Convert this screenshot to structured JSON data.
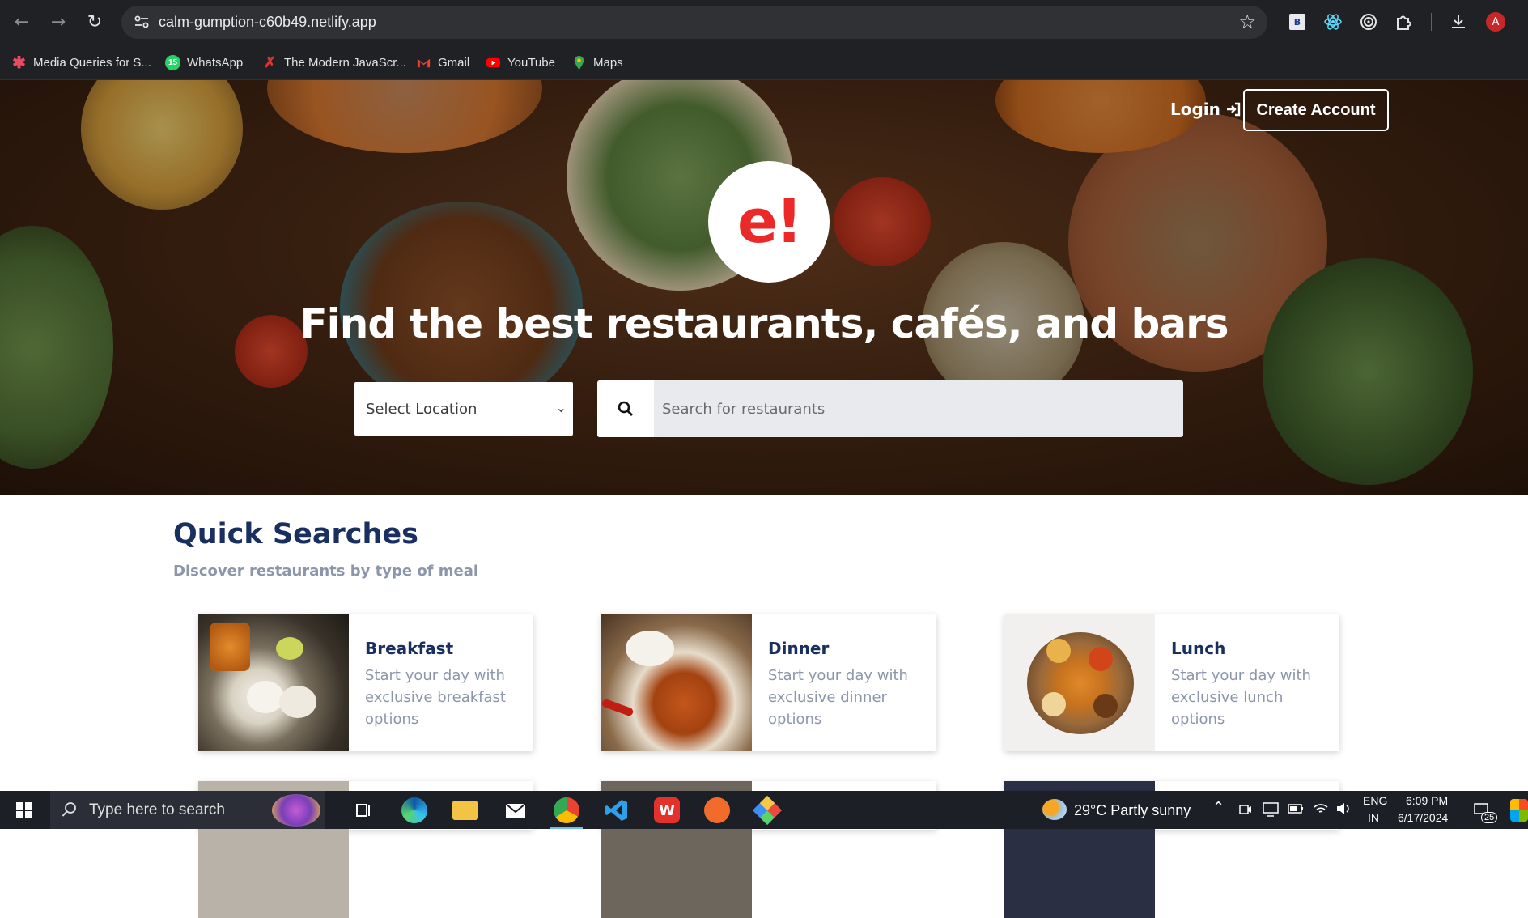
{
  "browser": {
    "url": "calm-gumption-c60b49.netlify.app",
    "bookmarks": [
      {
        "label": "Media Queries for S...",
        "icon": "asterisk-icon"
      },
      {
        "label": "WhatsApp",
        "icon": "whatsapp-icon",
        "badge": "15"
      },
      {
        "label": "The Modern JavaScr...",
        "icon": "javascript-tutorial-icon"
      },
      {
        "label": "Gmail",
        "icon": "gmail-icon"
      },
      {
        "label": "YouTube",
        "icon": "youtube-icon"
      },
      {
        "label": "Maps",
        "icon": "maps-pin-icon"
      }
    ],
    "profile_initial": "A",
    "ext_b_label": "B"
  },
  "hero": {
    "login_label": "Login",
    "create_account_label": "Create Account",
    "logo_text": "e!",
    "headline": "Find the best restaurants, cafés, and bars",
    "location_placeholder": "Select Location",
    "search_placeholder": "Search for restaurants"
  },
  "quick_searches": {
    "title": "Quick Searches",
    "subtitle": "Discover restaurants by type of meal",
    "cards": [
      {
        "title": "Breakfast",
        "description": "Start your day with exclusive breakfast options"
      },
      {
        "title": "Dinner",
        "description": "Start your day with exclusive dinner options"
      },
      {
        "title": "Lunch",
        "description": "Start your day with exclusive lunch options"
      }
    ]
  },
  "taskbar": {
    "search_placeholder": "Type here to search",
    "weather": "29°C  Partly sunny",
    "lang_top": "ENG",
    "lang_bottom": "IN",
    "time": "6:09 PM",
    "date": "6/17/2024",
    "notification_count": "25"
  },
  "colors": {
    "brand_red": "#eb2929",
    "navy": "#192f60",
    "muted": "#8c96ab"
  }
}
